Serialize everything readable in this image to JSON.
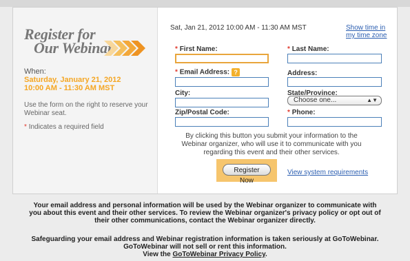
{
  "brand": {
    "title_line1": "Register for",
    "title_line2": "Our Webinar",
    "accent_color": "#f5a623"
  },
  "event": {
    "when_label": "When:",
    "date": "Saturday, January 21, 2012",
    "time": "10:00 AM - 11:30 AM MST",
    "schedule": "Sat, Jan 21, 2012 10:00 AM - 11:30 AM MST",
    "show_time_link": "Show time in my time zone"
  },
  "sidebar": {
    "instructions": "Use the form on the right to reserve your Webinar seat.",
    "required_note": "Indicates a required field",
    "required_marker": "*"
  },
  "form": {
    "first_name_label": "First Name:",
    "last_name_label": "Last Name:",
    "email_label": "Email Address:",
    "address_label": "Address:",
    "city_label": "City:",
    "state_label": "State/Province:",
    "state_value": "Choose one...",
    "zip_label": "Zip/Postal Code:",
    "phone_label": "Phone:",
    "help_icon_text": "?"
  },
  "submit": {
    "disclaimer": "By clicking this button you submit your information to the Webinar organizer, who will use it to communicate with you regarding this event and their other services.",
    "button_label": "Register Now",
    "system_requirements_link": "View system requirements"
  },
  "footer": {
    "privacy_notice": "Your email address and personal information will be used by the Webinar organizer to communicate with you about this event and their other services. To review the Webinar organizer's privacy policy or opt out of their other communications, contact the Webinar organizer directly.",
    "safeguard_line1": "Safeguarding your email address and Webinar registration information is taken seriously at GoToWebinar.",
    "safeguard_line2": "GoToWebinar will not sell or rent this information.",
    "view_prefix": "View the",
    "privacy_policy_link": "GoToWebinar Privacy Policy",
    "view_suffix": "."
  }
}
